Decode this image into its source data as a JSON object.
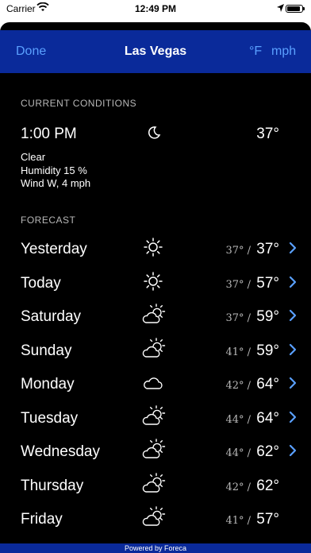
{
  "status": {
    "carrier": "Carrier",
    "time": "12:49 PM",
    "battery_level": 0.9
  },
  "nav": {
    "done": "Done",
    "title": "Las Vegas",
    "unit_temp": "°F",
    "unit_wind": "mph"
  },
  "current": {
    "section_label": "CURRENT CONDITIONS",
    "time": "1:00 PM",
    "icon": "moon-icon",
    "temp": "37°",
    "condition": "Clear",
    "humidity": "Humidity 15 %",
    "wind": "Wind W, 4 mph"
  },
  "forecast": {
    "section_label": "FORECAST",
    "days": [
      {
        "day": "Yesterday",
        "icon": "sun-icon",
        "low": "37° /",
        "high": "37°",
        "has_detail": true
      },
      {
        "day": "Today",
        "icon": "sun-icon",
        "low": "37° /",
        "high": "57°",
        "has_detail": true
      },
      {
        "day": "Saturday",
        "icon": "partly-cloudy-icon",
        "low": "37° /",
        "high": "59°",
        "has_detail": true
      },
      {
        "day": "Sunday",
        "icon": "partly-cloudy-icon",
        "low": "41° /",
        "high": "59°",
        "has_detail": true
      },
      {
        "day": "Monday",
        "icon": "cloud-icon",
        "low": "42° /",
        "high": "64°",
        "has_detail": true
      },
      {
        "day": "Tuesday",
        "icon": "partly-cloudy-icon",
        "low": "44° /",
        "high": "64°",
        "has_detail": true
      },
      {
        "day": "Wednesday",
        "icon": "partly-cloudy-icon",
        "low": "44° /",
        "high": "62°",
        "has_detail": true
      },
      {
        "day": "Thursday",
        "icon": "partly-cloudy-icon",
        "low": "42° /",
        "high": "62°",
        "has_detail": false
      },
      {
        "day": "Friday",
        "icon": "partly-cloudy-icon",
        "low": "41° /",
        "high": "57°",
        "has_detail": false
      }
    ]
  },
  "footer": {
    "text": "Powered by Foreca"
  },
  "colors": {
    "accent": "#5aa0ff",
    "nav_bg": "#0a2a9a",
    "background": "#000000"
  }
}
